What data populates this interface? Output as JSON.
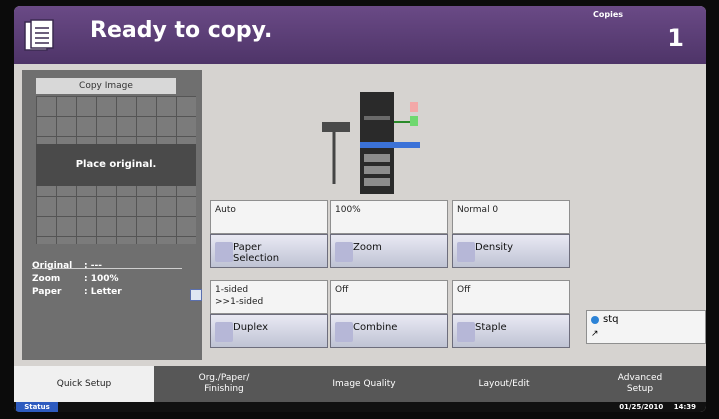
{
  "header": {
    "title": "Ready to copy.",
    "copies_label": "Copies",
    "copies_value": "1"
  },
  "preview": {
    "title": "Copy Image",
    "message": "Place original.",
    "original_label": "Original",
    "original_value": ": ---",
    "zoom_label": "Zoom",
    "zoom_value": ": 100%",
    "paper_label": "Paper",
    "paper_value": ": Letter"
  },
  "settings": {
    "row1": [
      {
        "status": "Auto",
        "button": "Paper\nSelection"
      },
      {
        "status": "100%",
        "button": "Zoom"
      },
      {
        "status": "Normal 0",
        "button": "Density"
      }
    ],
    "row2": [
      {
        "status": "1-sided\n>>1-sided",
        "button": "Duplex"
      },
      {
        "status": "Off",
        "button": "Combine"
      },
      {
        "status": "Off",
        "button": "Staple"
      }
    ],
    "shortcut": {
      "label": "stq"
    }
  },
  "tabs": [
    {
      "label": "Quick Setup",
      "active": true
    },
    {
      "label": "Org./Paper/\nFinishing",
      "active": false
    },
    {
      "label": "Image Quality",
      "active": false
    },
    {
      "label": "Layout/Edit",
      "active": false
    },
    {
      "label": "Advanced\nSetup",
      "active": false
    }
  ],
  "footer": {
    "status_button": "Status",
    "date": "01/25/2010",
    "time": "14:39"
  },
  "colors": {
    "header": "#5b3c76",
    "accent_blue": "#2e5bbf"
  }
}
